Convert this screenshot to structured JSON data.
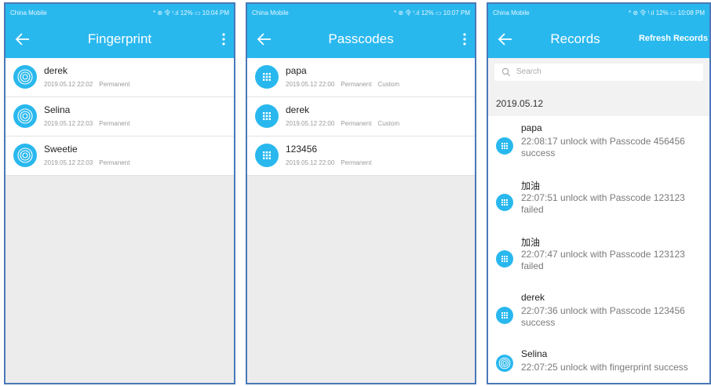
{
  "status_bar": {
    "carrier": "China Mobile",
    "right_panel_1": "* ⊛ 令 ᵗ.ıl 12% ▭ 10:04 PM",
    "right_panel_2": "* ⊛ 令 ᵗ.ıl 12% ▭ 10:07 PM",
    "right_panel_3": "* ⊛ 令 ᵗ.ıl 12% ▭ 10:08 PM"
  },
  "colors": {
    "accent": "#29b8ee",
    "panel_border": "#4a78b8",
    "background": "#ececec"
  },
  "fingerprint_screen": {
    "title": "Fingerprint",
    "items": [
      {
        "name": "derek",
        "date": "2019.05.12 22:02",
        "validity": "Permanent",
        "icon": "fingerprint-icon"
      },
      {
        "name": "Selina",
        "date": "2019.05.12 22:03",
        "validity": "Permanent",
        "icon": "fingerprint-icon"
      },
      {
        "name": "Sweetie",
        "date": "2019.05.12 22:03",
        "validity": "Permanent",
        "icon": "fingerprint-icon"
      }
    ]
  },
  "passcodes_screen": {
    "title": "Passcodes",
    "items": [
      {
        "name": "papa",
        "date": "2019.05.12 22:00",
        "validity": "Permanent",
        "type": "Custom",
        "icon": "keypad-icon"
      },
      {
        "name": "derek",
        "date": "2019.05.12 22:00",
        "validity": "Permanent",
        "type": "Custom",
        "icon": "keypad-icon"
      },
      {
        "name": "123456",
        "date": "2019.05.12 22:00",
        "validity": "Permanent",
        "type": "",
        "icon": "keypad-icon"
      }
    ]
  },
  "records_screen": {
    "title": "Records",
    "refresh_label": "Refresh Records",
    "search_placeholder": "Search",
    "date_header": "2019.05.12",
    "records": [
      {
        "name": "papa",
        "text": "22:08:17 unlock with Passcode 456456 success",
        "icon": "keypad-icon"
      },
      {
        "name": "加油",
        "text": "22:07:51 unlock with Passcode 123123 failed",
        "icon": "keypad-icon"
      },
      {
        "name": "加油",
        "text": "22:07:47 unlock with Passcode 123123 failed",
        "icon": "keypad-icon"
      },
      {
        "name": "derek",
        "text": "22:07:36 unlock with Passcode 123456 success",
        "icon": "keypad-icon"
      },
      {
        "name": "Selina",
        "text": "22:07:25 unlock with fingerprint success",
        "icon": "fingerprint-icon"
      }
    ]
  }
}
